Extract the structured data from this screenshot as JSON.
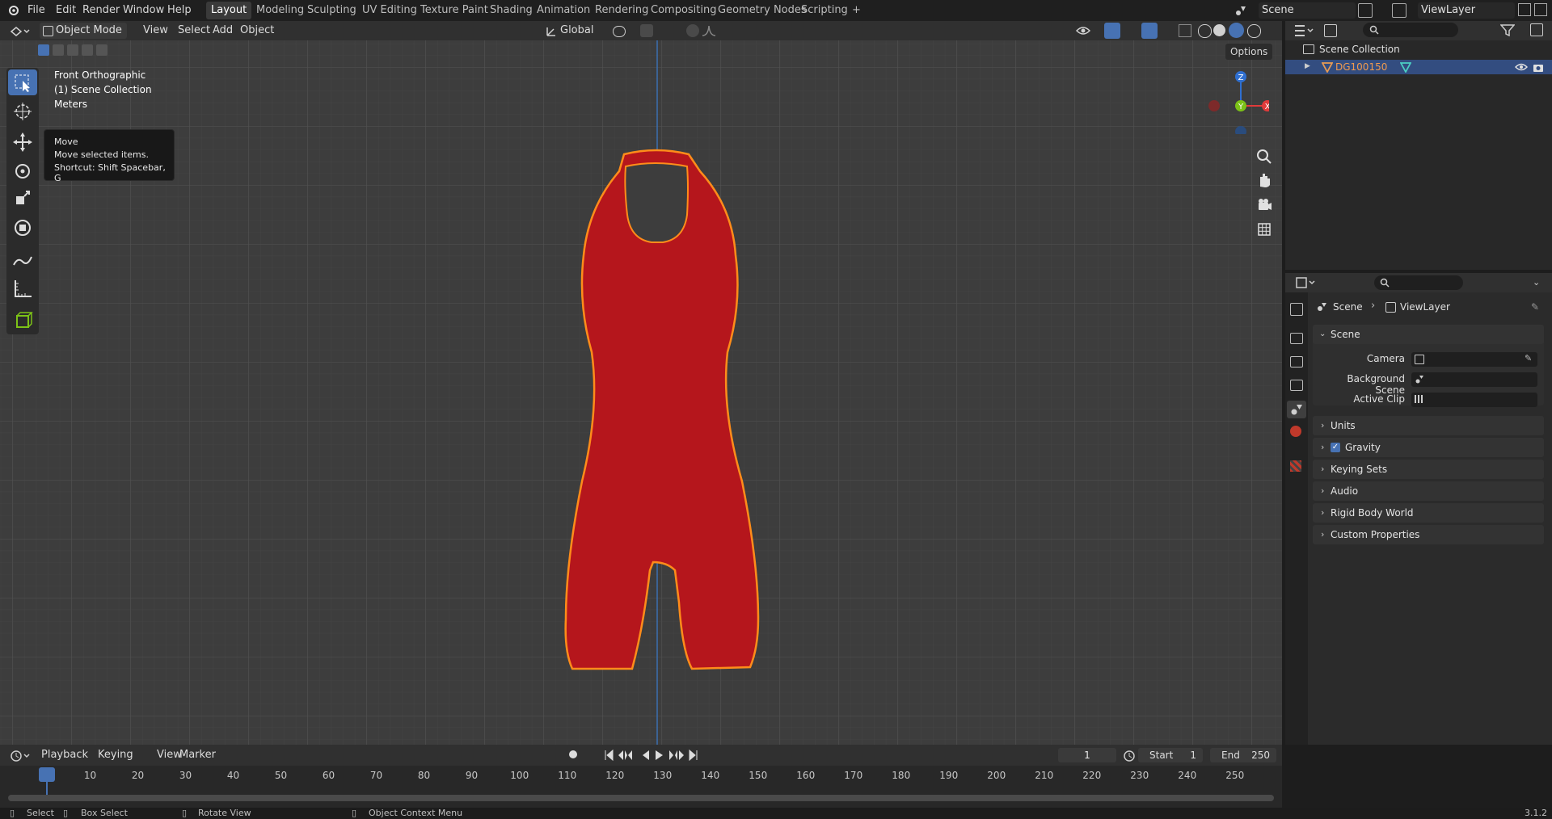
{
  "top_menu": [
    "File",
    "Edit",
    "Render",
    "Window",
    "Help"
  ],
  "workspace_tabs": [
    "Layout",
    "Modeling",
    "Sculpting",
    "UV Editing",
    "Texture Paint",
    "Shading",
    "Animation",
    "Rendering",
    "Compositing",
    "Geometry Nodes",
    "Scripting",
    "+"
  ],
  "active_workspace": "Layout",
  "scene_field": "Scene",
  "viewlayer_field": "ViewLayer",
  "viewport_header": {
    "mode": "Object Mode",
    "menus": [
      "View",
      "Select",
      "Add",
      "Object"
    ],
    "transform_orientation": "Global",
    "options": "Options"
  },
  "viewport_info": {
    "view": "Front Orthographic",
    "collection": "(1) Scene Collection",
    "units": "Meters"
  },
  "tooltip": {
    "title": "Move",
    "desc": "Move selected items.",
    "shortcut": "Shortcut: Shift Spacebar, G"
  },
  "gizmo": {
    "z": "Z",
    "y": "Y",
    "x": "X",
    "z_color": "#2f6fd0",
    "y_color": "#7cc217",
    "x_color": "#e03a3a"
  },
  "object_color": "#b5161c",
  "outline_color": "#ff8c1a",
  "outliner": {
    "root": "Scene Collection",
    "items": [
      {
        "name": "DG100150"
      }
    ]
  },
  "properties": {
    "breadcrumb": [
      "Scene",
      "ViewLayer"
    ],
    "scene_panel": "Scene",
    "fields": [
      {
        "label": "Camera"
      },
      {
        "label": "Background Scene"
      },
      {
        "label": "Active Clip"
      }
    ],
    "panels": [
      "Units",
      "Gravity",
      "Keying Sets",
      "Audio",
      "Rigid Body World",
      "Custom Properties"
    ],
    "gravity_checked": true
  },
  "timeline": {
    "menus": [
      "Playback",
      "Keying",
      "View",
      "Marker"
    ],
    "current_frame": "1",
    "start_label": "Start",
    "start": "1",
    "end_label": "End",
    "end": "250",
    "ruler": [
      "1",
      "10",
      "20",
      "30",
      "40",
      "50",
      "60",
      "70",
      "80",
      "90",
      "100",
      "110",
      "120",
      "130",
      "140",
      "150",
      "160",
      "170",
      "180",
      "190",
      "200",
      "210",
      "220",
      "230",
      "240",
      "250"
    ]
  },
  "statusbar": {
    "select": "Select",
    "box_select": "Box Select",
    "rotate_view": "Rotate View",
    "context_menu": "Object Context Menu",
    "version": "3.1.2"
  }
}
